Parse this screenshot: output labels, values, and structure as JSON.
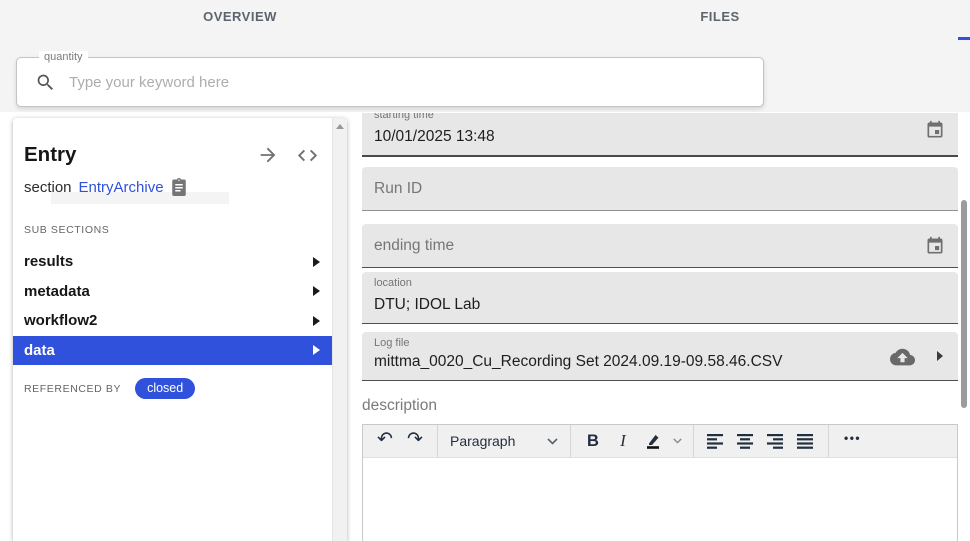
{
  "colors": {
    "accent": "#3051db"
  },
  "tabs": {
    "overview": "OVERVIEW",
    "files": "FILES"
  },
  "search": {
    "label": "quantity",
    "placeholder": "Type your keyword here"
  },
  "entry_panel": {
    "title": "Entry",
    "section_label": "section",
    "section_link": "EntryArchive",
    "subsections_label": "SUB SECTIONS",
    "items": [
      {
        "label": "results"
      },
      {
        "label": "metadata"
      },
      {
        "label": "workflow2"
      },
      {
        "label": "data"
      }
    ],
    "selected_item": "data",
    "referenced_by_label": "REFERENCED BY",
    "referenced_badge": "closed"
  },
  "form": {
    "starting_time": {
      "label": "starting time",
      "value": "10/01/2025 13:48"
    },
    "run_id": {
      "label": "Run ID",
      "value": ""
    },
    "ending_time": {
      "label": "ending time",
      "value": ""
    },
    "location": {
      "label": "location",
      "value": "DTU; IDOL Lab"
    },
    "log_file": {
      "label": "Log file",
      "value": "mittma_0020_Cu_Recording Set 2024.09.19-09.58.46.CSV"
    },
    "description_label": "description"
  },
  "editor": {
    "undo_glyph": "↶",
    "redo_glyph": "↷",
    "paragraph_label": "Paragraph",
    "bold_label": "B",
    "italic_label": "I",
    "more_glyph": "•••"
  }
}
